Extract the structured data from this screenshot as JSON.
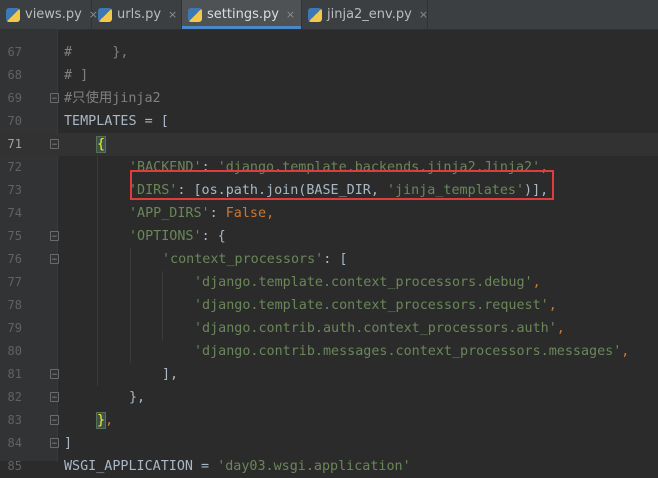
{
  "tabs": [
    {
      "label": "views.py",
      "close": "×"
    },
    {
      "label": "urls.py",
      "close": "×"
    },
    {
      "label": "settings.py",
      "close": "×",
      "active": true
    },
    {
      "label": "jinja2_env.py",
      "close": "×"
    }
  ],
  "lines": [
    {
      "num": "67",
      "fold": ""
    },
    {
      "num": "68",
      "fold": ""
    },
    {
      "num": "69",
      "fold": "−"
    },
    {
      "num": "70",
      "fold": ""
    },
    {
      "num": "71",
      "fold": "−"
    },
    {
      "num": "72",
      "fold": ""
    },
    {
      "num": "73",
      "fold": ""
    },
    {
      "num": "74",
      "fold": ""
    },
    {
      "num": "75",
      "fold": "−"
    },
    {
      "num": "76",
      "fold": "−"
    },
    {
      "num": "77",
      "fold": ""
    },
    {
      "num": "78",
      "fold": ""
    },
    {
      "num": "79",
      "fold": ""
    },
    {
      "num": "80",
      "fold": ""
    },
    {
      "num": "81",
      "fold": "−"
    },
    {
      "num": "82",
      "fold": "−"
    },
    {
      "num": "83",
      "fold": "−"
    },
    {
      "num": "84",
      "fold": "−"
    },
    {
      "num": "85",
      "fold": ""
    }
  ],
  "code": {
    "l67": "#     },",
    "l68": "# ]",
    "l69": "#只使用jinja2",
    "l70_a": "TEMPLATES",
    "l70_b": " = [",
    "l71_brace": "{",
    "l72_key": "'BACKEND'",
    "l72_sep": ": ",
    "l72_val": "'django.template.backends.jinja2.Jinja2'",
    "l72_end": ",",
    "l73_key": "'DIRS'",
    "l73_mid": ": [os.path.join(BASE_DIR, ",
    "l73_val": "'jinja_templates'",
    "l73_end": ")],",
    "l74_key": "'APP_DIRS'",
    "l74_sep": ": ",
    "l74_val": "False",
    "l74_end": ",",
    "l75_key": "'OPTIONS'",
    "l75_end": ": {",
    "l76_key": "'context_processors'",
    "l76_end": ": [",
    "l77_val": "'django.template.context_processors.debug'",
    "l78_val": "'django.template.context_processors.request'",
    "l79_val": "'django.contrib.auth.context_processors.auth'",
    "l80_val": "'django.contrib.messages.context_processors.messages'",
    "comma": ",",
    "l81": "],",
    "l82": "},",
    "l83_brace": "}",
    "l83_end": ",",
    "l84": "]",
    "l85_a": "WSGI_APPLICATION",
    "l85_b": " = ",
    "l85_val": "'day03.wsgi.application'"
  },
  "colors": {
    "background": "#2b2b2b",
    "gutter": "#313335",
    "string": "#6a8759",
    "keyword": "#cc7832",
    "comment": "#808080",
    "highlight_box": "#e03c3c",
    "active_tab_accent": "#4a88c7"
  }
}
